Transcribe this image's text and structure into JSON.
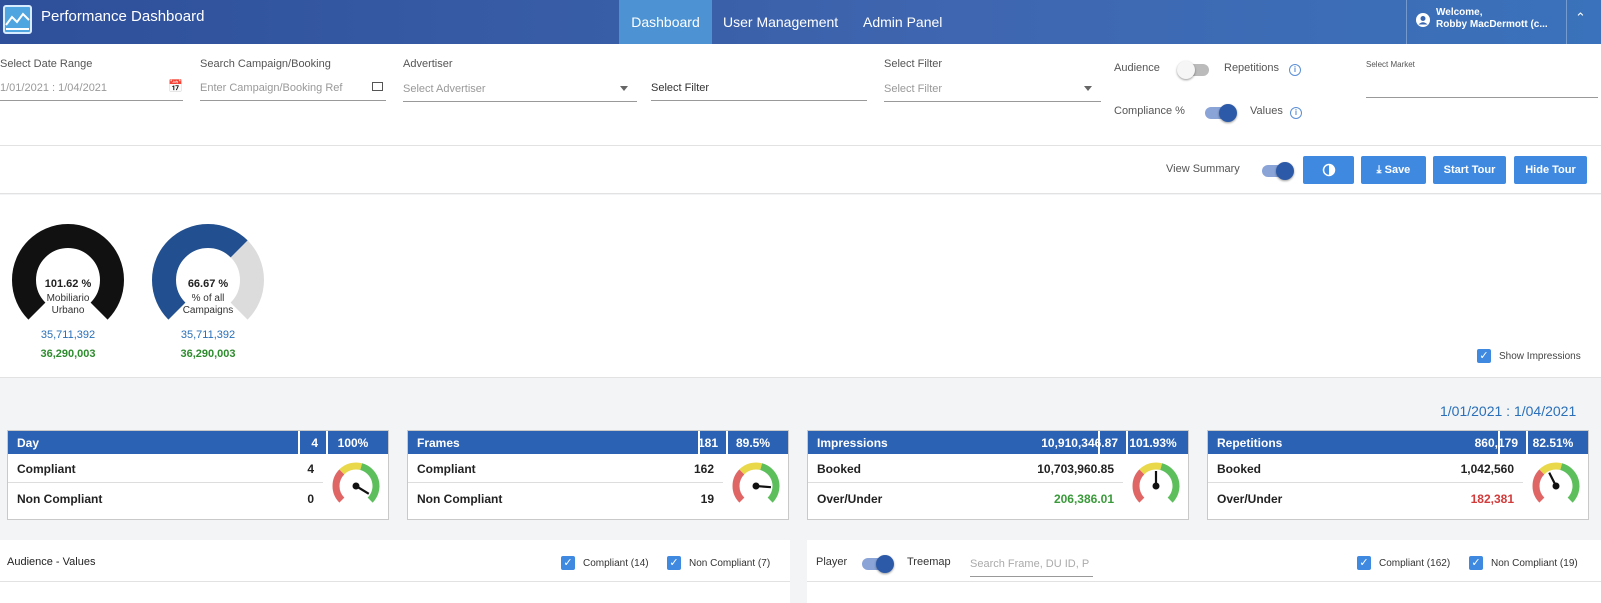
{
  "app": {
    "title": "Performance Dashboard",
    "nav": [
      "Dashboard",
      "User Management",
      "Admin Panel"
    ],
    "welcome": "Welcome,",
    "user": "Robby MacDermott (c..."
  },
  "filters": {
    "date_label": "Select Date Range",
    "date_value": "1/01/2021 : 1/04/2021",
    "search_label": "Search Campaign/Booking",
    "search_placeholder": "Enter Campaign/Booking Ref",
    "advertiser_label": "Advertiser",
    "advertiser_value": "Select Advertiser",
    "filter_text": "Select Filter",
    "filter2_label": "Select Filter",
    "filter2_value": "Select Filter",
    "audience": "Audience",
    "repetitions": "Repetitions",
    "compliance": "Compliance %",
    "values": "Values",
    "market_label": "Select Market"
  },
  "toolbar": {
    "view_summary": "View Summary",
    "save": "Save",
    "start_tour": "Start Tour",
    "hide_tour": "Hide Tour"
  },
  "gauges": [
    {
      "pct": "101.62 %",
      "label1": "Mobiliario",
      "label2": "Urbano",
      "v1": "35,711,392",
      "v2": "36,290,003",
      "fill": 1.0,
      "color": "#111111"
    },
    {
      "pct": "66.67 %",
      "label1": "% of all",
      "label2": "Campaigns",
      "v1": "35,711,392",
      "v2": "36,290,003",
      "fill": 0.6667,
      "color": "#214f8f"
    }
  ],
  "show_impressions": "Show Impressions",
  "date_range": "1/01/2021 : 1/04/2021",
  "cards": [
    {
      "title": "Day",
      "count": "4",
      "pct": "100%",
      "r1": "Compliant",
      "r1v": "4",
      "r2": "Non Compliant",
      "r2v": "0",
      "r2color": "#222222",
      "needle": 0.95
    },
    {
      "title": "Frames",
      "count": "181",
      "pct": "89.5%",
      "r1": "Compliant",
      "r1v": "162",
      "r2": "Non Compliant",
      "r2v": "19",
      "r2color": "#222222",
      "needle": 0.85
    },
    {
      "title": "Impressions",
      "count": "10,910,346.87",
      "pct": "101.93%",
      "r1": "Booked",
      "r1v": "10,703,960.85",
      "r2": "Over/Under",
      "r2v": "206,386.01",
      "r2color": "#3a9a3a",
      "needle": 0.5
    },
    {
      "title": "Repetitions",
      "count": "860,179",
      "pct": "82.51%",
      "r1": "Booked",
      "r1v": "1,042,560",
      "r2": "Over/Under",
      "r2v": "182,381",
      "r2color": "#d33a3a",
      "needle": 0.4
    }
  ],
  "bottom": {
    "title": "Audience - Values",
    "compliant1": "Compliant (14)",
    "noncompliant1": "Non Compliant (7)",
    "player": "Player",
    "treemap": "Treemap",
    "search_placeholder": "Search Frame, DU ID, P",
    "compliant2": "Compliant (162)",
    "noncompliant2": "Non Compliant (19)"
  },
  "colors": {
    "header": "#2e4f99",
    "accent": "#3f8ae0",
    "card_header": "#2b62b4"
  }
}
